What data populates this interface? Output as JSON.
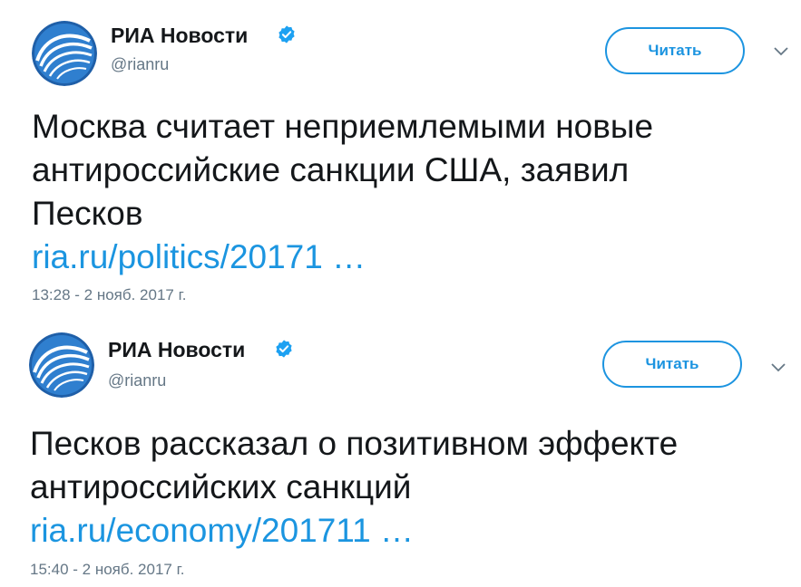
{
  "colors": {
    "accent": "#1b95e0",
    "text": "#14171a",
    "secondary": "#657786",
    "verified": "#1da1f2"
  },
  "tweets": [
    {
      "author_name": "РИА Новости",
      "handle": "@rianru",
      "verified_icon": "verified-badge-icon",
      "follow_label": "Читать",
      "text_lines": [
        "Москва считает неприемлемыми новые",
        "антироссийские санкции США, заявил",
        "Песков"
      ],
      "link": "ria.ru/politics/20171 …",
      "timestamp": "13:28 - 2 нояб. 2017 г."
    },
    {
      "author_name": "РИА Новости",
      "handle": "@rianru",
      "verified_icon": "verified-badge-icon",
      "follow_label": "Читать",
      "text_lines": [
        "Песков рассказал о позитивном эффекте",
        "антироссийских санкций"
      ],
      "link": "ria.ru/economy/201711 …",
      "timestamp": "15:40 - 2 нояб. 2017 г."
    }
  ]
}
